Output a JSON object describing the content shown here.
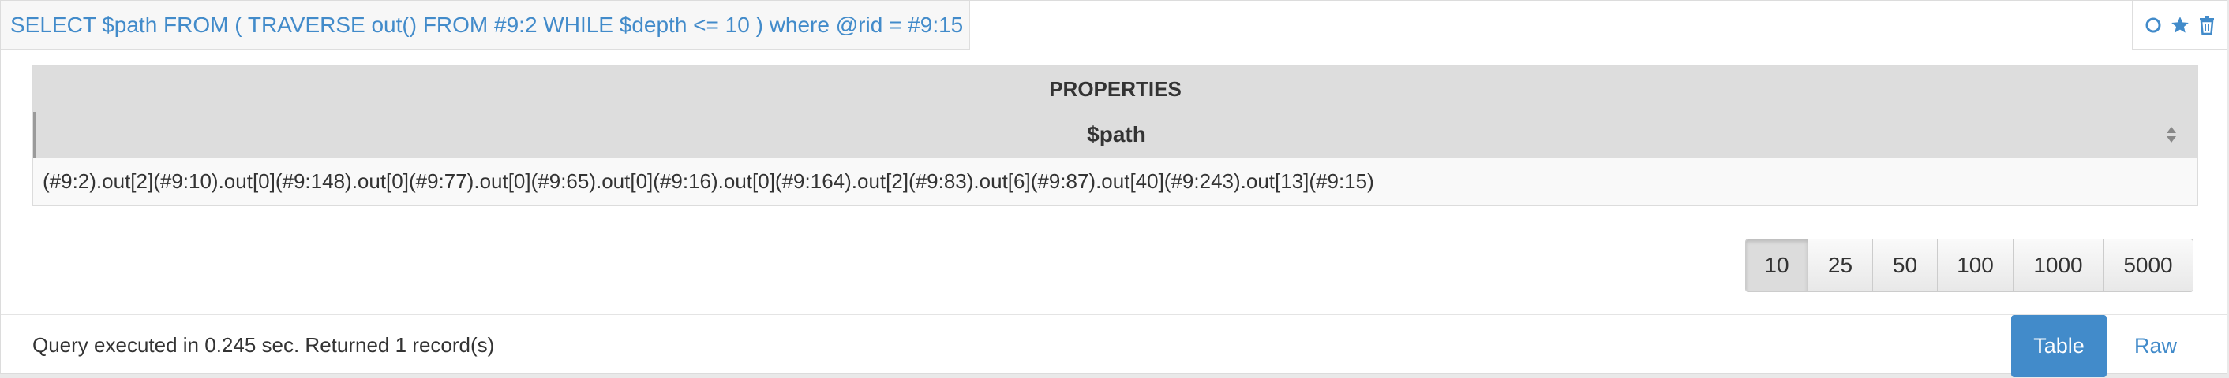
{
  "query": {
    "text": "SELECT $path FROM ( TRAVERSE out() FROM #9:2 WHILE $depth <= 10 ) where @rid = #9:15"
  },
  "actions": {
    "icons": [
      "circle-icon",
      "star-icon",
      "trash-icon"
    ],
    "color": "#428bca"
  },
  "table": {
    "group_header": "PROPERTIES",
    "columns": [
      "$path"
    ],
    "rows": [
      [
        "(#9:2).out[2](#9:10).out[0](#9:148).out[0](#9:77).out[0](#9:65).out[0](#9:16).out[0](#9:164).out[2](#9:83).out[6](#9:87).out[40](#9:243).out[13](#9:15)"
      ]
    ]
  },
  "pagination": {
    "sizes": [
      "10",
      "25",
      "50",
      "100",
      "1000",
      "5000"
    ],
    "selected": "10"
  },
  "footer": {
    "status": "Query executed in 0.245 sec. Returned 1 record(s)",
    "view_buttons": [
      "Table",
      "Raw"
    ],
    "active_view": "Table"
  },
  "colors": {
    "accent": "#428bca",
    "header_bg": "#dddddd"
  }
}
